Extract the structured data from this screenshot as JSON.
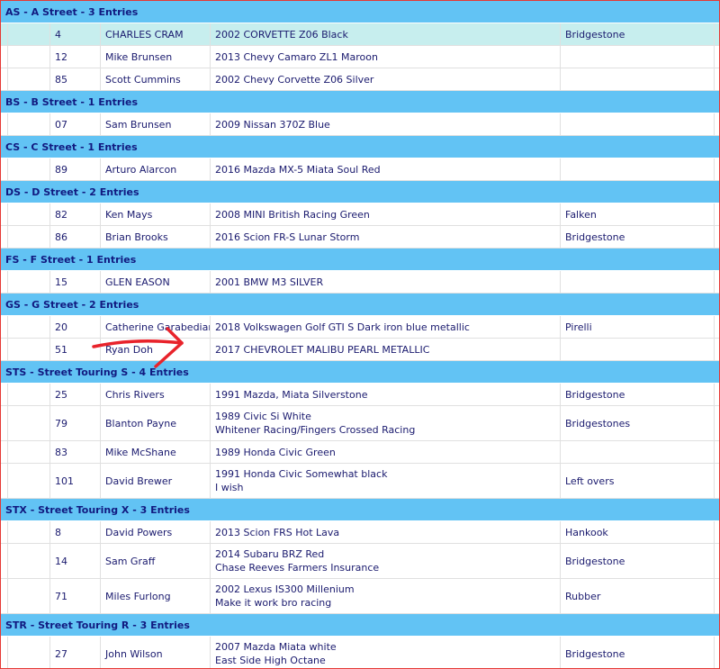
{
  "annotation": {
    "color": "#e8232b"
  },
  "groups": [
    {
      "header": "AS - A Street - 3 Entries",
      "rows": [
        {
          "num": "4",
          "driver": "CHARLES CRAM",
          "car": [
            "2002 CORVETTE Z06 Black"
          ],
          "tire": "Bridgestone",
          "highlight": true
        },
        {
          "num": "12",
          "driver": "Mike Brunsen",
          "car": [
            "2013 Chevy Camaro ZL1 Maroon"
          ],
          "tire": ""
        },
        {
          "num": "85",
          "driver": "Scott Cummins",
          "car": [
            "2002 Chevy Corvette Z06 Silver"
          ],
          "tire": ""
        }
      ]
    },
    {
      "header": "BS - B Street - 1 Entries",
      "rows": [
        {
          "num": "07",
          "driver": "Sam Brunsen",
          "car": [
            "2009 Nissan 370Z Blue"
          ],
          "tire": ""
        }
      ]
    },
    {
      "header": "CS - C Street - 1 Entries",
      "rows": [
        {
          "num": "89",
          "driver": "Arturo Alarcon",
          "car": [
            "2016 Mazda MX-5 Miata Soul Red"
          ],
          "tire": ""
        }
      ]
    },
    {
      "header": "DS - D Street - 2 Entries",
      "rows": [
        {
          "num": "82",
          "driver": "Ken Mays",
          "car": [
            "2008 MINI British Racing Green"
          ],
          "tire": "Falken"
        },
        {
          "num": "86",
          "driver": "Brian Brooks",
          "car": [
            "2016 Scion FR-S Lunar Storm"
          ],
          "tire": "Bridgestone"
        }
      ]
    },
    {
      "header": "FS - F Street - 1 Entries",
      "rows": [
        {
          "num": "15",
          "driver": "GLEN EASON",
          "car": [
            "2001 BMW M3 SILVER"
          ],
          "tire": ""
        }
      ]
    },
    {
      "header": "GS - G Street - 2 Entries",
      "rows": [
        {
          "num": "20",
          "driver": "Catherine Garabedian",
          "car": [
            "2018 Volkswagen Golf GTI S Dark iron blue metallic"
          ],
          "tire": "Pirelli"
        },
        {
          "num": "51",
          "driver": "Ryan Doh",
          "car": [
            "2017 CHEVROLET MALIBU PEARL METALLIC"
          ],
          "tire": ""
        }
      ]
    },
    {
      "header": "STS - Street Touring S - 4 Entries",
      "rows": [
        {
          "num": "25",
          "driver": "Chris Rivers",
          "car": [
            "1991 Mazda, Miata Silverstone"
          ],
          "tire": "Bridgestone"
        },
        {
          "num": "79",
          "driver": "Blanton Payne",
          "car": [
            "1989 Civic Si White",
            "Whitener Racing/Fingers Crossed Racing"
          ],
          "tire": "Bridgestones"
        },
        {
          "num": "83",
          "driver": "Mike McShane",
          "car": [
            "1989 Honda Civic Green"
          ],
          "tire": ""
        },
        {
          "num": "101",
          "driver": "David Brewer",
          "car": [
            "1991 Honda Civic  Somewhat black",
            "I wish"
          ],
          "tire": "Left overs"
        }
      ]
    },
    {
      "header": "STX - Street Touring X - 3 Entries",
      "rows": [
        {
          "num": "8",
          "driver": "David Powers",
          "car": [
            "2013 Scion FRS Hot Lava"
          ],
          "tire": "Hankook"
        },
        {
          "num": "14",
          "driver": "Sam Graff",
          "car": [
            "2014 Subaru BRZ Red",
            "Chase Reeves Farmers Insurance"
          ],
          "tire": "Bridgestone"
        },
        {
          "num": "71",
          "driver": "Miles Furlong",
          "car": [
            "2002 Lexus IS300 Millenium",
            "Make it work bro racing"
          ],
          "tire": "Rubber"
        }
      ]
    },
    {
      "header": "STR - Street Touring R - 3 Entries",
      "rows": [
        {
          "num": "27",
          "driver": "John Wilson",
          "car": [
            "2007 Mazda Miata white",
            "East Side High Octane"
          ],
          "tire": "Bridgestone"
        }
      ]
    }
  ]
}
